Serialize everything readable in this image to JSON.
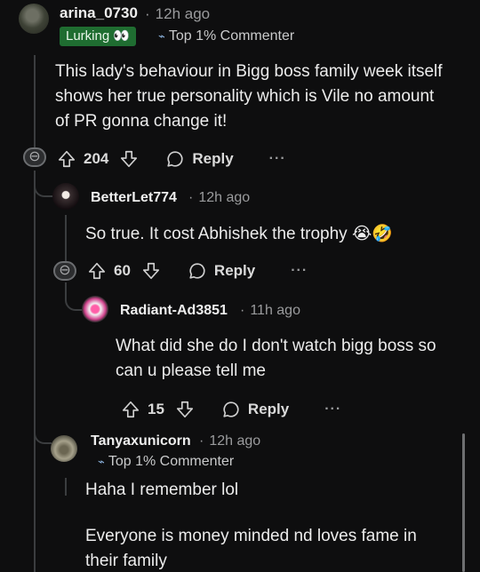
{
  "comments": [
    {
      "username": "arina_0730",
      "time": "12h ago",
      "flair": "Lurking 👀",
      "badge": "Top 1% Commenter",
      "body": "This lady's behaviour in Bigg boss family week itself shows her true personality which is Vile no amount of PR gonna change it!",
      "votes": "204",
      "reply_label": "Reply",
      "more": "···"
    },
    {
      "username": "BetterLet774",
      "time": "12h ago",
      "body": "So true. It cost Abhishek the trophy 😭🤣",
      "votes": "60",
      "reply_label": "Reply",
      "more": "···"
    },
    {
      "username": "Radiant-Ad3851",
      "time": "11h ago",
      "body": "What did she do I don't watch bigg boss so can u please tell me",
      "votes": "15",
      "reply_label": "Reply",
      "more": "···"
    },
    {
      "username": "Tanyaxunicorn",
      "time": "12h ago",
      "badge": "Top 1% Commenter",
      "body_lines": [
        "Haha I remember lol",
        "Everyone is money minded nd loves fame in their family"
      ]
    }
  ],
  "colors": {
    "background": "#0e0e0f",
    "flair_green": "#1f6d31",
    "thread_line": "#3b3d3f"
  }
}
